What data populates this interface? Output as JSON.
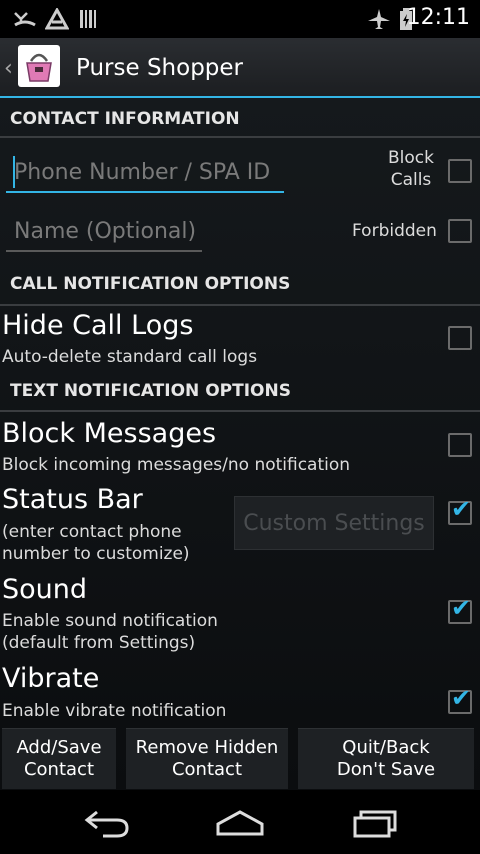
{
  "status": {
    "time": "12:11",
    "left_icons": [
      "missed-call-icon",
      "notification-icon",
      "barcode-icon"
    ],
    "right_icons": [
      "airplane-mode-icon",
      "battery-icon"
    ]
  },
  "actionbar": {
    "title": "Purse Shopper"
  },
  "contact": {
    "header": "CONTACT INFORMATION",
    "phone_placeholder": "Phone Number / SPA ID",
    "name_placeholder": "Name (Optional)",
    "block_label": "Block\nCalls",
    "forbidden_label": "Forbidden"
  },
  "call_opts": {
    "header": "CALL NOTIFICATION OPTIONS",
    "hide_title": "Hide Call Logs",
    "hide_sub": "Auto-delete standard call logs"
  },
  "text_opts": {
    "header": "TEXT NOTIFICATION OPTIONS",
    "block_title": "Block Messages",
    "block_sub": "Block incoming messages/no notification",
    "status_title": "Status Bar",
    "status_sub": "(enter contact phone\nnumber to customize)",
    "custom_settings": "Custom Settings",
    "sound_title": "Sound",
    "sound_sub": "Enable sound notification\n(default from Settings)",
    "vibrate_title": "Vibrate",
    "vibrate_sub": "Enable vibrate notification"
  },
  "buttons": {
    "add_save": "Add/Save\nContact",
    "remove_hidden": "Remove Hidden\nContact",
    "quit_back": "Quit/Back\nDon't Save"
  },
  "checkbox_states": {
    "block_calls": false,
    "forbidden": false,
    "hide_call_logs": false,
    "block_messages": false,
    "status_bar": true,
    "sound": true,
    "vibrate": true
  },
  "colors": {
    "accent": "#33b5e5",
    "background": "#0b0d0f"
  },
  "nav_icons": [
    "back-icon",
    "home-icon",
    "recent-apps-icon"
  ]
}
